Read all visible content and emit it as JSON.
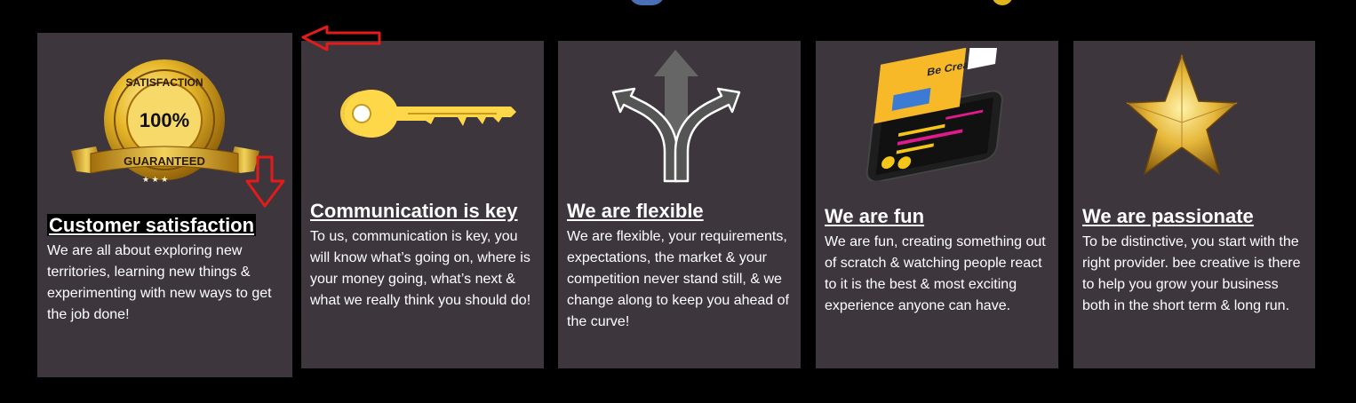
{
  "colors": {
    "page_bg": "#000000",
    "card_bg": "#3d363d",
    "text": "#ffffff",
    "accent_gold": "#e8b82a",
    "annotation_red": "#e31b1b"
  },
  "cards": [
    {
      "icon": "satisfaction-badge-icon",
      "badge_top": "SATISFACTION",
      "badge_center": "100%",
      "badge_ribbon": "GUARANTEED",
      "title": "Customer satisfaction",
      "body": "We are all about exploring new territories, learning new things & experimenting with new ways to get the job done!"
    },
    {
      "icon": "key-icon",
      "title": "Communication is key",
      "body": "To us, communication is key, you will know what’s going on, where is your money going, what’s next & what we really think you should do!"
    },
    {
      "icon": "split-arrows-icon",
      "title": "We are flexible",
      "body": "We are flexible, your requirements, expectations, the market & your competition never stand still, & we change along to keep you ahead of the curve!"
    },
    {
      "icon": "phone-mockup-icon",
      "phone_text": "Be Creative",
      "title": "We are fun",
      "body": "We are fun, creating something out of scratch & watching people react to it is the best & most exciting experience anyone can have."
    },
    {
      "icon": "star-icon",
      "title": "We are passionate",
      "body": "To be distinctive, you start with the right provider. bee creative is there to help you grow your business both in the short term & long run."
    }
  ],
  "annotations": [
    {
      "icon": "left-arrow-annotation-icon"
    },
    {
      "icon": "down-arrow-annotation-icon"
    }
  ]
}
